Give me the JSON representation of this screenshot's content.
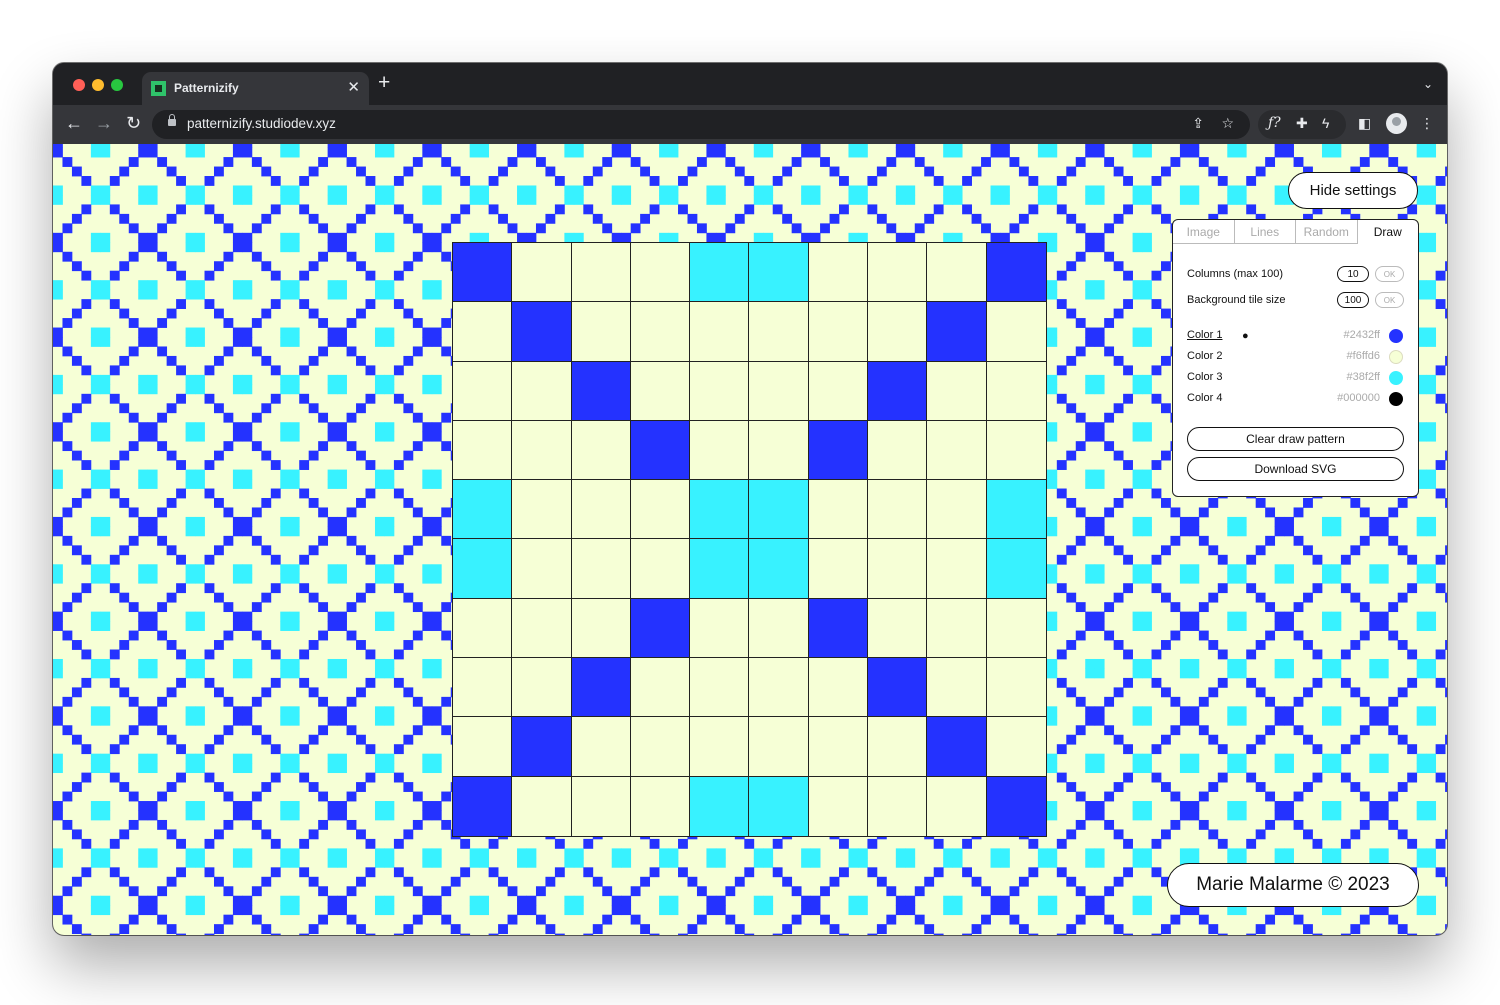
{
  "browser": {
    "tab_title": "Patternizify",
    "tab_close": "✕",
    "new_tab": "+",
    "url": "patternizify.studiodev.xyz",
    "traffic_lights": [
      "#ff5f57",
      "#febc2e",
      "#28c840"
    ]
  },
  "app": {
    "hide_settings_label": "Hide settings",
    "credit": "Marie Malarme © 2023",
    "panel": {
      "tabs": [
        {
          "label": "Image",
          "active": false
        },
        {
          "label": "Lines",
          "active": false
        },
        {
          "label": "Random",
          "active": false
        },
        {
          "label": "Draw",
          "active": true
        }
      ],
      "columns_label": "Columns (max 100)",
      "columns_value": "10",
      "tile_size_label": "Background tile size",
      "tile_size_value": "100",
      "ok_label": "OK",
      "colors": [
        {
          "name": "Color 1",
          "hex": "#2432ff",
          "selected": true
        },
        {
          "name": "Color 2",
          "hex": "#f6ffd6",
          "selected": false
        },
        {
          "name": "Color 3",
          "hex": "#38f2ff",
          "selected": false
        },
        {
          "name": "Color 4",
          "hex": "#000000",
          "selected": false
        }
      ],
      "selected_marker": "●",
      "clear_label": "Clear draw pattern",
      "download_label": "Download SVG"
    },
    "pattern": {
      "columns": 10,
      "cells": [
        [
          1,
          2,
          2,
          2,
          3,
          3,
          2,
          2,
          2,
          1
        ],
        [
          2,
          1,
          2,
          2,
          2,
          2,
          2,
          2,
          1,
          2
        ],
        [
          2,
          2,
          1,
          2,
          2,
          2,
          2,
          1,
          2,
          2
        ],
        [
          2,
          2,
          2,
          1,
          2,
          2,
          1,
          2,
          2,
          2
        ],
        [
          3,
          2,
          2,
          2,
          3,
          3,
          2,
          2,
          2,
          3
        ],
        [
          3,
          2,
          2,
          2,
          3,
          3,
          2,
          2,
          2,
          3
        ],
        [
          2,
          2,
          2,
          1,
          2,
          2,
          1,
          2,
          2,
          2
        ],
        [
          2,
          2,
          1,
          2,
          2,
          2,
          2,
          1,
          2,
          2
        ],
        [
          2,
          1,
          2,
          2,
          2,
          2,
          2,
          2,
          1,
          2
        ],
        [
          1,
          2,
          2,
          2,
          3,
          3,
          2,
          2,
          2,
          1
        ]
      ]
    }
  }
}
